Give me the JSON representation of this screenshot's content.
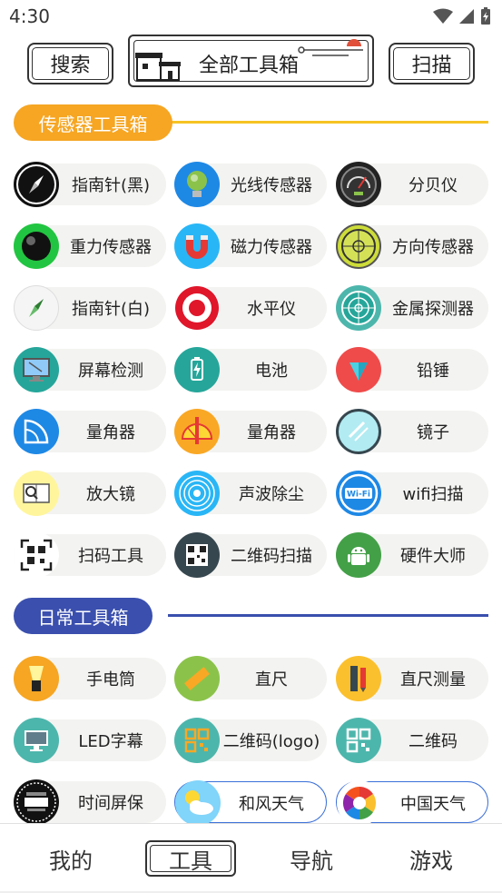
{
  "status": {
    "time": "4:30"
  },
  "header": {
    "search_label": "搜索",
    "title": "全部工具箱",
    "scan_label": "扫描"
  },
  "sections": [
    {
      "title": "传感器工具箱",
      "color": "#f6a623",
      "line_color": "#f6c323"
    },
    {
      "title": "日常工具箱",
      "color": "#3a4fae",
      "line_color": "#3a4fae"
    }
  ],
  "sensor_tools": [
    {
      "label": "指南针(黑)",
      "icon": "compass-black-icon"
    },
    {
      "label": "光线传感器",
      "icon": "light-bulb-icon"
    },
    {
      "label": "分贝仪",
      "icon": "decibel-meter-icon"
    },
    {
      "label": "重力传感器",
      "icon": "gravity-ball-icon"
    },
    {
      "label": "磁力传感器",
      "icon": "magnet-icon"
    },
    {
      "label": "方向传感器",
      "icon": "level-crosshair-icon"
    },
    {
      "label": "指南针(白)",
      "icon": "compass-white-icon"
    },
    {
      "label": "水平仪",
      "icon": "target-icon"
    },
    {
      "label": "金属探测器",
      "icon": "radar-icon"
    },
    {
      "label": "屏幕检测",
      "icon": "monitor-icon"
    },
    {
      "label": "电池",
      "icon": "battery-icon"
    },
    {
      "label": "铅锤",
      "icon": "plumb-bob-icon"
    },
    {
      "label": "量角器",
      "icon": "protractor-icon"
    },
    {
      "label": "量角器",
      "icon": "protractor-pencil-icon"
    },
    {
      "label": "镜子",
      "icon": "mirror-icon"
    },
    {
      "label": "放大镜",
      "icon": "magnifier-book-icon"
    },
    {
      "label": "声波除尘",
      "icon": "sound-wave-icon"
    },
    {
      "label": "wifi扫描",
      "icon": "wifi-icon"
    },
    {
      "label": "扫码工具",
      "icon": "scan-code-icon"
    },
    {
      "label": "二维码扫描",
      "icon": "qr-scan-icon"
    },
    {
      "label": "硬件大师",
      "icon": "android-icon"
    }
  ],
  "daily_tools": [
    {
      "label": "手电筒",
      "icon": "flashlight-icon"
    },
    {
      "label": "直尺",
      "icon": "ruler-icon"
    },
    {
      "label": "直尺测量",
      "icon": "ruler-pencil-icon"
    },
    {
      "label": "LED字幕",
      "icon": "led-monitor-icon"
    },
    {
      "label": "二维码(logo)",
      "icon": "qr-logo-icon"
    },
    {
      "label": "二维码",
      "icon": "qr-code-icon"
    },
    {
      "label": "时间屏保",
      "icon": "clock-screensaver-icon"
    },
    {
      "label": "和风天气",
      "icon": "weather-sun-cloud-icon"
    },
    {
      "label": "中国天气",
      "icon": "china-weather-icon"
    }
  ],
  "nav": [
    {
      "label": "我的"
    },
    {
      "label": "工具",
      "active": true
    },
    {
      "label": "导航"
    },
    {
      "label": "游戏"
    }
  ]
}
